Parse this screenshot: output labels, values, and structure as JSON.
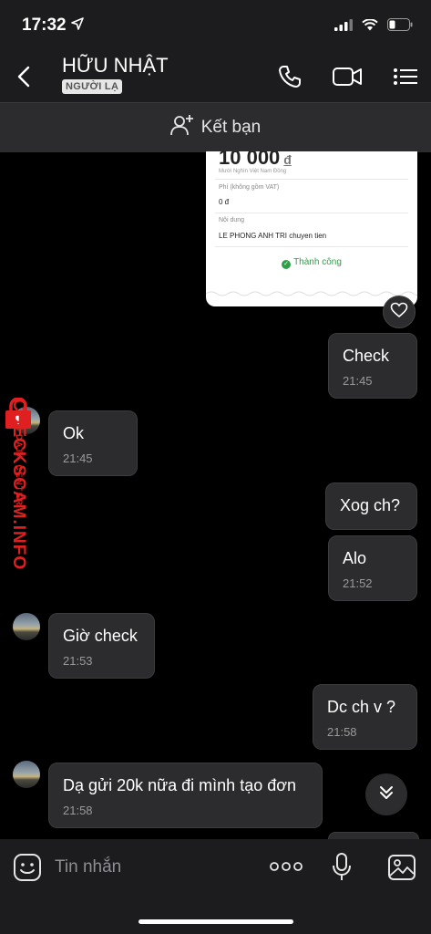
{
  "status": {
    "time": "17:32"
  },
  "header": {
    "contact_name": "HỮU NHẬT",
    "badge": "NGƯỜI LẠ"
  },
  "friend_bar": {
    "label": "Kết bạn"
  },
  "receipt": {
    "amount": "10 000",
    "currency": "đ",
    "amount_words": "Mười Nghìn Việt Nam Đồng",
    "fee_label": "Phí (không gồm VAT)",
    "fee_value": "0 đ",
    "content_label": "Nội dung",
    "content_value": "LE PHONG ANH TRI chuyen tien",
    "status": "Thành công"
  },
  "messages": [
    {
      "side": "out",
      "text": "Check",
      "time": "21:45"
    },
    {
      "side": "in",
      "text": "Ok",
      "time": "21:45"
    },
    {
      "side": "out",
      "text": "Xog ch?",
      "time": ""
    },
    {
      "side": "out",
      "text": "Alo",
      "time": "21:52"
    },
    {
      "side": "in",
      "text": "Giờ check",
      "time": "21:53"
    },
    {
      "side": "out",
      "text": "Dc ch  v ?",
      "time": "21:58"
    },
    {
      "side": "in",
      "text": "Dạ gửi 20k nữa đi mình tạo đơn",
      "time": "21:58"
    }
  ],
  "watermark": {
    "main": "CHECKSCAM.INFO",
    "sub": "DATA CENTER"
  },
  "composer": {
    "placeholder": "Tin nhắn"
  },
  "icons": [
    "location-arrow-icon",
    "signal-icon",
    "wifi-icon",
    "battery-icon",
    "back-icon",
    "phone-icon",
    "video-icon",
    "menu-icon",
    "add-friend-icon",
    "heart-icon",
    "lock-icon",
    "chevrons-down-icon",
    "sticker-icon",
    "more-icon",
    "mic-icon",
    "image-icon"
  ],
  "colors": {
    "background": "#000000",
    "bubble": "#2c2c2e",
    "header": "#1c1c1e",
    "success": "#2e9e48",
    "watermark": "#e02020"
  }
}
